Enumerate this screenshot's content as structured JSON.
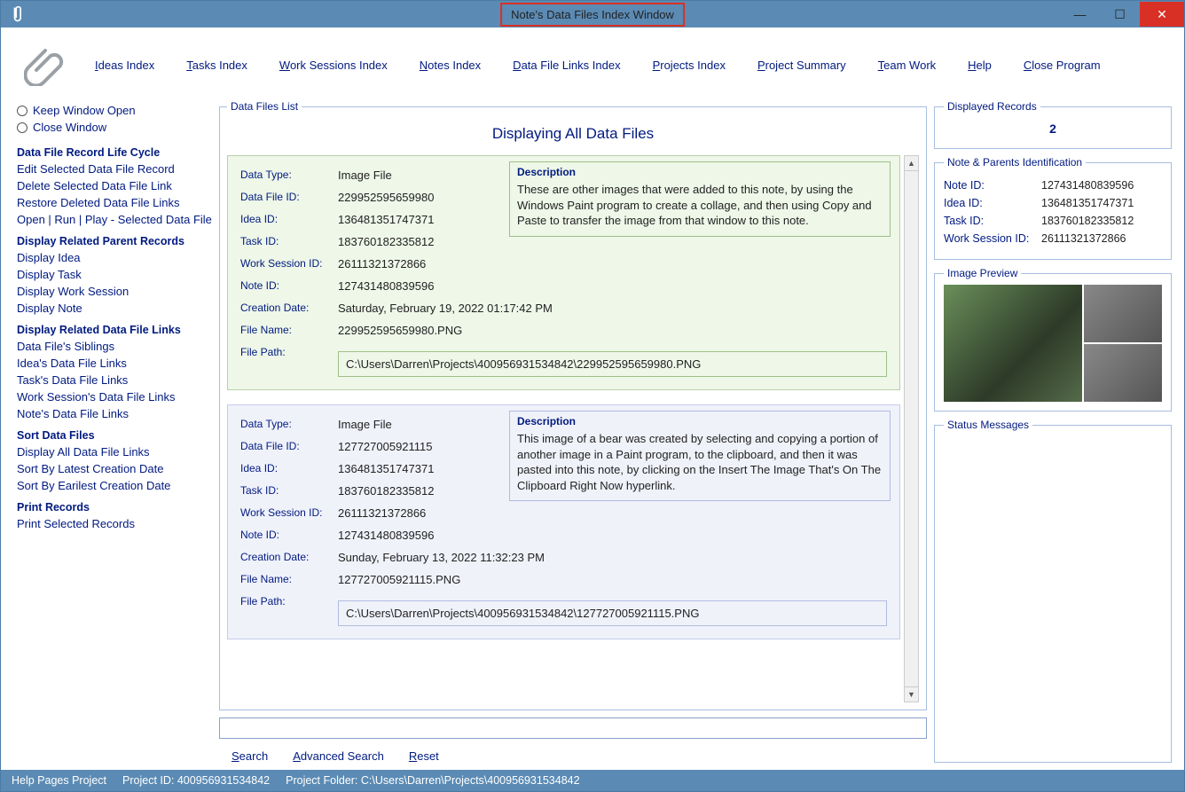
{
  "window": {
    "title": "Note's Data Files Index Window"
  },
  "menu": {
    "items": [
      "Ideas Index",
      "Tasks Index",
      "Work Sessions Index",
      "Notes Index",
      "Data File Links Index",
      "Projects Index",
      "Project Summary",
      "Team Work",
      "Help",
      "Close Program"
    ],
    "underlines": [
      "I",
      "T",
      "W",
      "N",
      "D",
      "P",
      "P",
      "T",
      "H",
      "C"
    ]
  },
  "radios": {
    "keep": "Keep Window Open",
    "close": "Close Window"
  },
  "sidebar": {
    "s1": {
      "head": "Data File Record Life Cycle",
      "items": [
        "Edit Selected Data File Record",
        "Delete Selected Data File Link",
        "Restore Deleted Data File Links",
        "Open | Run | Play - Selected Data File"
      ]
    },
    "s2": {
      "head": "Display Related Parent Records",
      "items": [
        "Display Idea",
        "Display Task",
        "Display Work Session",
        "Display Note"
      ]
    },
    "s3": {
      "head": "Display Related Data File Links",
      "items": [
        "Data File's Siblings",
        "Idea's Data File Links",
        "Task's Data File Links",
        "Work Session's Data File Links",
        "Note's Data File Links"
      ]
    },
    "s4": {
      "head": "Sort Data Files",
      "items": [
        "Display All Data File Links",
        "Sort By Latest Creation Date",
        "Sort By Earilest Creation Date"
      ]
    },
    "s5": {
      "head": "Print Records",
      "items": [
        "Print Selected Records"
      ]
    }
  },
  "list": {
    "legend": "Data Files List",
    "title": "Displaying All Data Files",
    "labels": {
      "dtype": "Data Type:",
      "dfid": "Data File ID:",
      "idea": "Idea ID:",
      "task": "Task ID:",
      "ws": "Work Session ID:",
      "note": "Note ID:",
      "cdate": "Creation Date:",
      "fname": "File Name:",
      "fpath": "File Path:",
      "desc": "Description"
    },
    "cards": [
      {
        "dtype": "Image File",
        "dfid": "229952595659980",
        "idea": "136481351747371",
        "task": "183760182335812",
        "ws": "26111321372866",
        "note": "127431480839596",
        "cdate": "Saturday, February 19, 2022   01:17:42 PM",
        "fname": "229952595659980.PNG",
        "fpath": "C:\\Users\\Darren\\Projects\\400956931534842\\229952595659980.PNG",
        "desc": "These are other images that were added to this note, by using the Windows Paint program to create a collage, and then using Copy and Paste to transfer the image from that window to this note."
      },
      {
        "dtype": "Image File",
        "dfid": "127727005921115",
        "idea": "136481351747371",
        "task": "183760182335812",
        "ws": "26111321372866",
        "note": "127431480839596",
        "cdate": "Sunday, February 13, 2022   11:32:23 PM",
        "fname": "127727005921115.PNG",
        "fpath": "C:\\Users\\Darren\\Projects\\400956931534842\\127727005921115.PNG",
        "desc": "This image of a bear was created by selecting and copying a portion of another image in a Paint program, to the clipboard, and then it was pasted into this note, by clicking on the Insert The Image That's On The Clipboard Right Now hyperlink."
      }
    ]
  },
  "search": {
    "search": "Search",
    "adv": "Advanced Search",
    "reset": "Reset",
    "placeholder": ""
  },
  "right": {
    "records": {
      "legend": "Displayed Records",
      "count": "2"
    },
    "ids": {
      "legend": "Note & Parents Identification",
      "rows": [
        {
          "lbl": "Note ID:",
          "val": "127431480839596"
        },
        {
          "lbl": "Idea ID:",
          "val": "136481351747371"
        },
        {
          "lbl": "Task ID:",
          "val": "183760182335812"
        },
        {
          "lbl": "Work Session ID:",
          "val": "26111321372866"
        }
      ]
    },
    "preview": {
      "legend": "Image Preview"
    },
    "status": {
      "legend": "Status Messages"
    }
  },
  "statusbar": {
    "help": "Help Pages Project",
    "pid": "Project ID:  400956931534842",
    "pfolder": "Project Folder: C:\\Users\\Darren\\Projects\\400956931534842"
  }
}
